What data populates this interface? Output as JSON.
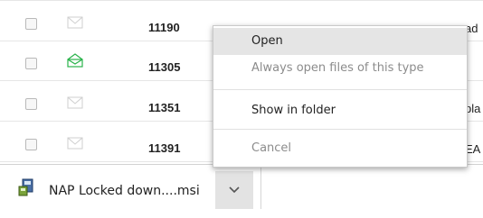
{
  "rows": [
    {
      "id": "11190",
      "trailing_text": "ad",
      "icon": "envelope-closed-icon",
      "icon_color": "#cfcfcf"
    },
    {
      "id": "11305",
      "trailing_text": "",
      "icon": "envelope-open-icon",
      "icon_color": "#2ab34b"
    },
    {
      "id": "11351",
      "trailing_text": "pla",
      "icon": "envelope-closed-icon",
      "icon_color": "#cfcfcf"
    },
    {
      "id": "11391",
      "trailing_text": "EA",
      "icon": "envelope-closed-icon",
      "icon_color": "#cfcfcf"
    }
  ],
  "context_menu": {
    "open": "Open",
    "always_open": "Always open files of this type",
    "show_in_folder": "Show in folder",
    "cancel": "Cancel"
  },
  "download_shelf": {
    "file_name": "NAP Locked down....msi",
    "file_icon": "msi-installer-icon",
    "menu_button_icon": "chevron-down-icon"
  }
}
